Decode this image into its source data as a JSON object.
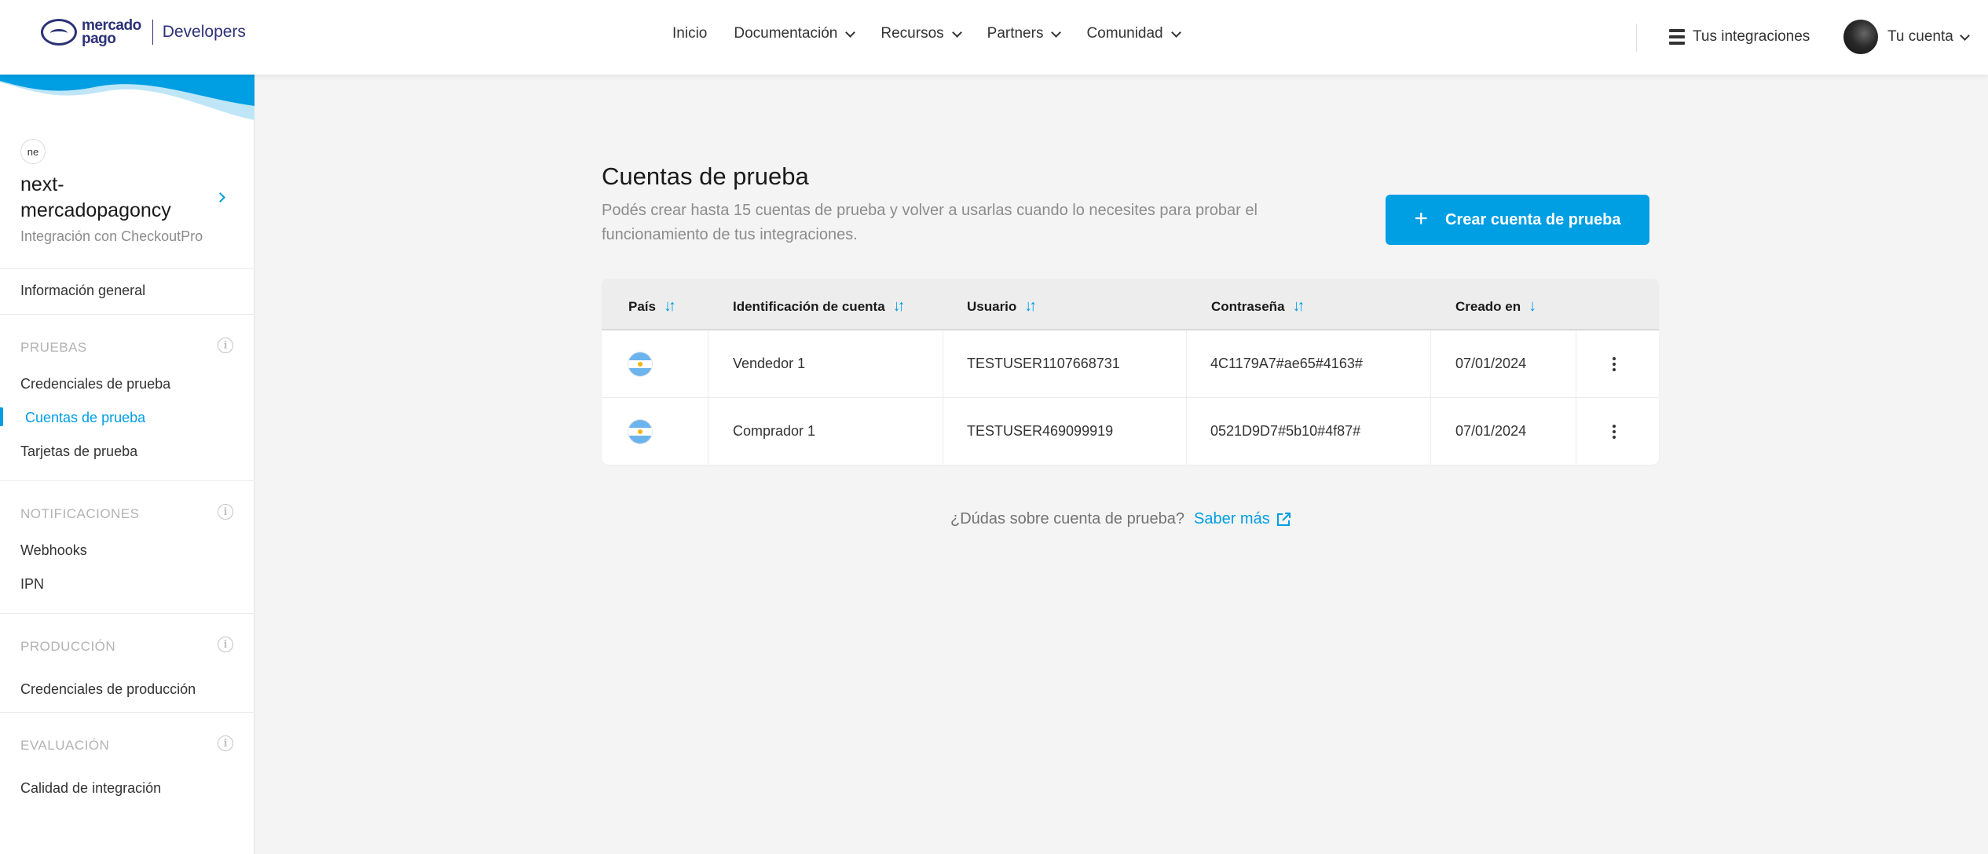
{
  "header": {
    "logo_text_line1": "mercado",
    "logo_text_line2": "pago",
    "logo_section": "Developers",
    "nav": [
      {
        "label": "Inicio"
      },
      {
        "label": "Documentación"
      },
      {
        "label": "Recursos"
      },
      {
        "label": "Partners"
      },
      {
        "label": "Comunidad"
      }
    ],
    "integrations_label": "Tus integraciones",
    "account_label": "Tu cuenta"
  },
  "sidebar": {
    "app_badge": "ne",
    "app_name": "next-mercadopagoncy",
    "app_subtitle": "Integración con CheckoutPro",
    "general_info": "Información general",
    "sections": {
      "pruebas": {
        "title": "PRUEBAS",
        "items": [
          "Credenciales de prueba",
          "Cuentas de prueba",
          "Tarjetas de prueba"
        ]
      },
      "notificaciones": {
        "title": "NOTIFICACIONES",
        "items": [
          "Webhooks",
          "IPN"
        ]
      },
      "produccion": {
        "title": "PRODUCCIÓN",
        "items": [
          "Credenciales de producción"
        ]
      },
      "evaluacion": {
        "title": "EVALUACIÓN",
        "items": [
          "Calidad de integración"
        ]
      }
    },
    "active_item": "Cuentas de prueba",
    "accent_color": "#009ee3"
  },
  "main": {
    "title": "Cuentas de prueba",
    "description": "Podés crear hasta 15 cuentas de prueba y volver a usarlas cuando lo necesites para probar el funcionamiento de tus integraciones.",
    "create_button": "Crear cuenta de prueba",
    "table": {
      "columns": [
        "País",
        "Identificación de cuenta",
        "Usuario",
        "Contraseña",
        "Creado en"
      ],
      "rows": [
        {
          "country": "argentina-flag",
          "account_id": "Vendedor 1",
          "user": "TESTUSER1107668731",
          "password": "4C1179A7#ae65#4163#",
          "created": "07/01/2024"
        },
        {
          "country": "argentina-flag",
          "account_id": "Comprador 1",
          "user": "TESTUSER469099919",
          "password": "0521D9D7#5b10#4f87#",
          "created": "07/01/2024"
        }
      ]
    },
    "help_text": "¿Dúdas sobre cuenta de prueba?",
    "help_link": "Saber más"
  }
}
